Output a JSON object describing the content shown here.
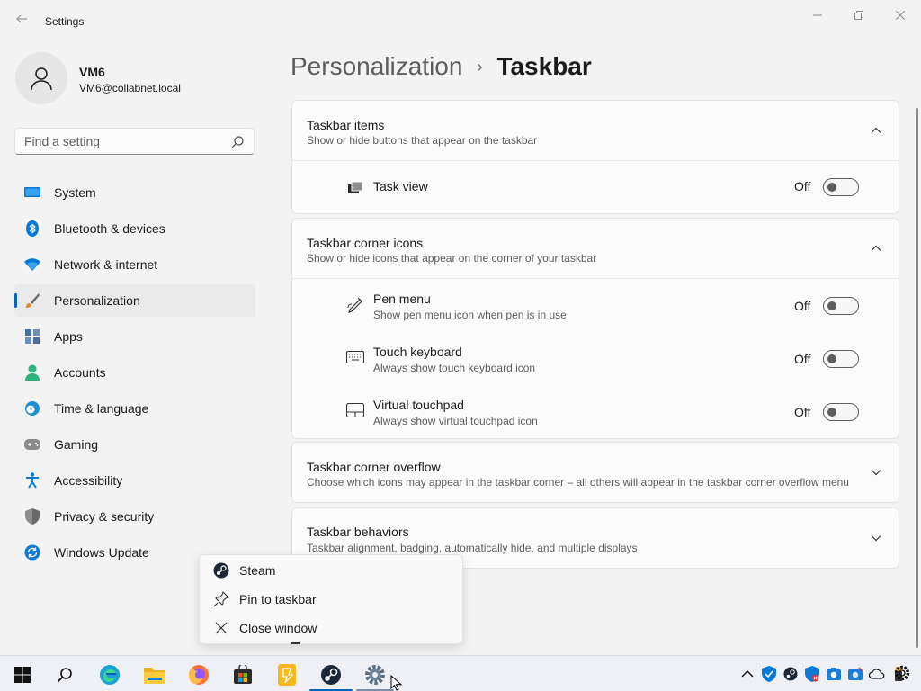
{
  "window": {
    "app_title": "Settings",
    "controls": [
      "minimize",
      "maximize",
      "close"
    ]
  },
  "profile": {
    "name": "VM6",
    "email": "VM6@collabnet.local"
  },
  "search": {
    "placeholder": "Find a setting"
  },
  "nav": {
    "items": [
      {
        "label": "System",
        "icon": "monitor-icon",
        "active": false
      },
      {
        "label": "Bluetooth & devices",
        "icon": "bluetooth-icon",
        "active": false
      },
      {
        "label": "Network & internet",
        "icon": "wifi-icon",
        "active": false
      },
      {
        "label": "Personalization",
        "icon": "paintbrush-icon",
        "active": true
      },
      {
        "label": "Apps",
        "icon": "apps-icon",
        "active": false
      },
      {
        "label": "Accounts",
        "icon": "person-icon",
        "active": false
      },
      {
        "label": "Time & language",
        "icon": "clock-globe-icon",
        "active": false
      },
      {
        "label": "Gaming",
        "icon": "gamepad-icon",
        "active": false
      },
      {
        "label": "Accessibility",
        "icon": "accessibility-icon",
        "active": false
      },
      {
        "label": "Privacy & security",
        "icon": "shield-icon",
        "active": false
      },
      {
        "label": "Windows Update",
        "icon": "update-icon",
        "active": false
      }
    ]
  },
  "breadcrumb": {
    "parent": "Personalization",
    "separator": "›",
    "current": "Taskbar"
  },
  "sections": {
    "taskbar_items": {
      "title": "Taskbar items",
      "subtitle": "Show or hide buttons that appear on the taskbar",
      "expanded": true,
      "rows": [
        {
          "title": "Task view",
          "state": "Off",
          "icon": "task-view-icon"
        }
      ]
    },
    "corner_icons": {
      "title": "Taskbar corner icons",
      "subtitle": "Show or hide icons that appear on the corner of your taskbar",
      "expanded": true,
      "rows": [
        {
          "title": "Pen menu",
          "subtitle": "Show pen menu icon when pen is in use",
          "state": "Off",
          "icon": "pen-icon"
        },
        {
          "title": "Touch keyboard",
          "subtitle": "Always show touch keyboard icon",
          "state": "Off",
          "icon": "keyboard-icon"
        },
        {
          "title": "Virtual touchpad",
          "subtitle": "Always show virtual touchpad icon",
          "state": "Off",
          "icon": "touchpad-icon"
        }
      ]
    },
    "corner_overflow": {
      "title": "Taskbar corner overflow",
      "subtitle": "Choose which icons may appear in the taskbar corner – all others will appear in the taskbar corner overflow menu",
      "expanded": false
    },
    "behaviors": {
      "title": "Taskbar behaviors",
      "subtitle": "Taskbar alignment, badging, automatically hide, and multiple displays",
      "expanded": false
    }
  },
  "context_menu": {
    "items": [
      {
        "label": "Steam",
        "icon": "steam-icon"
      },
      {
        "label": "Pin to taskbar",
        "icon": "pin-icon"
      },
      {
        "label": "Close window",
        "icon": "close-icon"
      }
    ]
  },
  "taskbar": {
    "apps": [
      "start-icon",
      "search-icon",
      "edge-icon",
      "file-explorer-icon",
      "firefox-icon",
      "store-icon",
      "app-icon",
      "steam-icon",
      "settings-icon"
    ],
    "tray": [
      "chevron-up-icon",
      "security-icon",
      "steam-tray-icon",
      "defender-icon",
      "screenshot-icon",
      "camera-icon",
      "onedrive-icon",
      "usb-icon",
      "settings-tray-icon"
    ]
  },
  "colors": {
    "accent": "#0067c0",
    "background": "#f3f3f3",
    "card": "#fbfbfb"
  }
}
